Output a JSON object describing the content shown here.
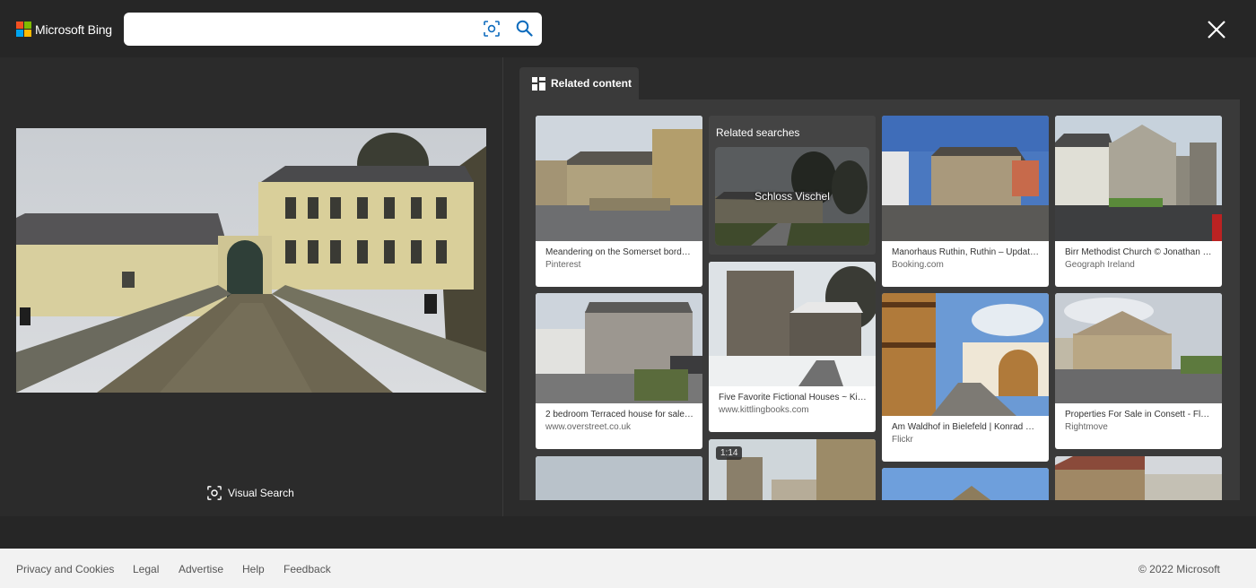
{
  "header": {
    "brand": "Microsoft Bing",
    "search": {
      "value": "",
      "placeholder": ""
    },
    "icons": {
      "visual_search": "visual-search-icon",
      "search": "search-icon",
      "close": "close-icon"
    }
  },
  "left": {
    "visual_search_label": "Visual Search"
  },
  "right": {
    "tab_label": "Related content",
    "related_searches": {
      "title": "Related searches",
      "items": [
        {
          "label": "Schloss Vischel"
        }
      ]
    },
    "cards": [
      {
        "caption": "Meandering on the Somerset borde…",
        "source": "Pinterest"
      },
      {
        "caption": "Manorhaus Ruthin, Ruthin – Updat…",
        "source": "Booking.com"
      },
      {
        "caption": "Birr Methodist Church © Jonathan …",
        "source": "Geograph Ireland"
      },
      {
        "caption": "2 bedroom Terraced house for sale…",
        "source": "www.overstreet.co.uk"
      },
      {
        "caption": "Five Favorite Fictional Houses ~ Kit…",
        "source": "www.kittlingbooks.com"
      },
      {
        "caption": "Am Waldhof in Bielefeld | Konrad St…",
        "source": "Flickr"
      },
      {
        "caption": "Properties For Sale in Consett - Flat…",
        "source": "Rightmove"
      }
    ],
    "video_duration": "1:14"
  },
  "footer": {
    "links": [
      "Privacy and Cookies",
      "Legal",
      "Advertise",
      "Help",
      "Feedback"
    ],
    "copyright": "© 2022 Microsoft"
  },
  "colors": {
    "header_bg": "#262626",
    "page_bg": "#2b2b2b",
    "panel_bg": "#3a3a3a",
    "accent": "#0f6cbd",
    "footer_bg": "#f2f2f2"
  }
}
